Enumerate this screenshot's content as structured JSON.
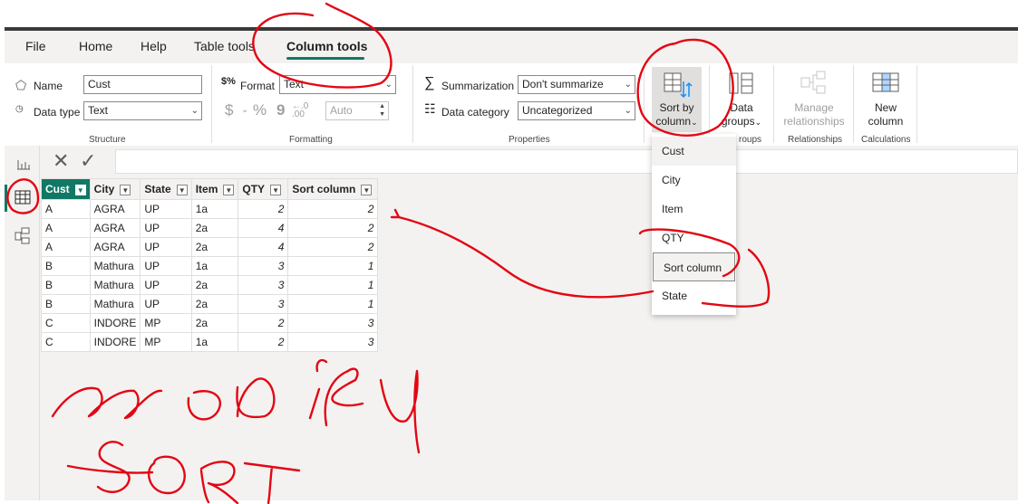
{
  "ribbon": {
    "tabs": [
      {
        "label": "File"
      },
      {
        "label": "Home"
      },
      {
        "label": "Help"
      },
      {
        "label": "Table tools"
      },
      {
        "label": "Column tools"
      }
    ],
    "structure": {
      "name_label": "Name",
      "name_value": "Cust",
      "datatype_label": "Data type",
      "datatype_value": "Text",
      "group_label": "Structure"
    },
    "formatting": {
      "format_label": "Format",
      "format_value": "Text",
      "currency_symbol": "$",
      "percent_symbol": "%",
      "comma_symbol": "9",
      "auto_value": "Auto",
      "group_label": "Formatting"
    },
    "properties": {
      "summarization_label": "Summarization",
      "summarization_value": "Don't summarize",
      "category_label": "Data category",
      "category_value": "Uncategorized",
      "group_label": "Properties"
    },
    "sort": {
      "line1": "Sort by",
      "line2": "column",
      "group_label_partial": "roups"
    },
    "data_groups": {
      "line1": "Data",
      "line2": "groups"
    },
    "relationships": {
      "line1": "Manage",
      "line2": "relationships",
      "group_label": "Relationships"
    },
    "new_column": {
      "line1": "New",
      "line2": "column",
      "group_label": "Calculations"
    }
  },
  "sort_dropdown": {
    "items": [
      "Cust",
      "City",
      "Item",
      "QTY",
      "Sort column",
      "State"
    ],
    "selected": "Sort column"
  },
  "table": {
    "columns": [
      "Cust",
      "City",
      "State",
      "Item",
      "QTY",
      "Sort column"
    ],
    "rows": [
      [
        "A",
        "AGRA",
        "UP",
        "1a",
        "2",
        "2"
      ],
      [
        "A",
        "AGRA",
        "UP",
        "2a",
        "4",
        "2"
      ],
      [
        "A",
        "AGRA",
        "UP",
        "2a",
        "4",
        "2"
      ],
      [
        "B",
        "Mathura",
        "UP",
        "1a",
        "3",
        "1"
      ],
      [
        "B",
        "Mathura",
        "UP",
        "2a",
        "3",
        "1"
      ],
      [
        "B",
        "Mathura",
        "UP",
        "2a",
        "3",
        "1"
      ],
      [
        "C",
        "INDORE",
        "MP",
        "2a",
        "2",
        "3"
      ],
      [
        "C",
        "INDORE",
        "MP",
        "1a",
        "2",
        "3"
      ]
    ]
  },
  "colors": {
    "accent": "#117865",
    "annotation": "#e30613"
  }
}
